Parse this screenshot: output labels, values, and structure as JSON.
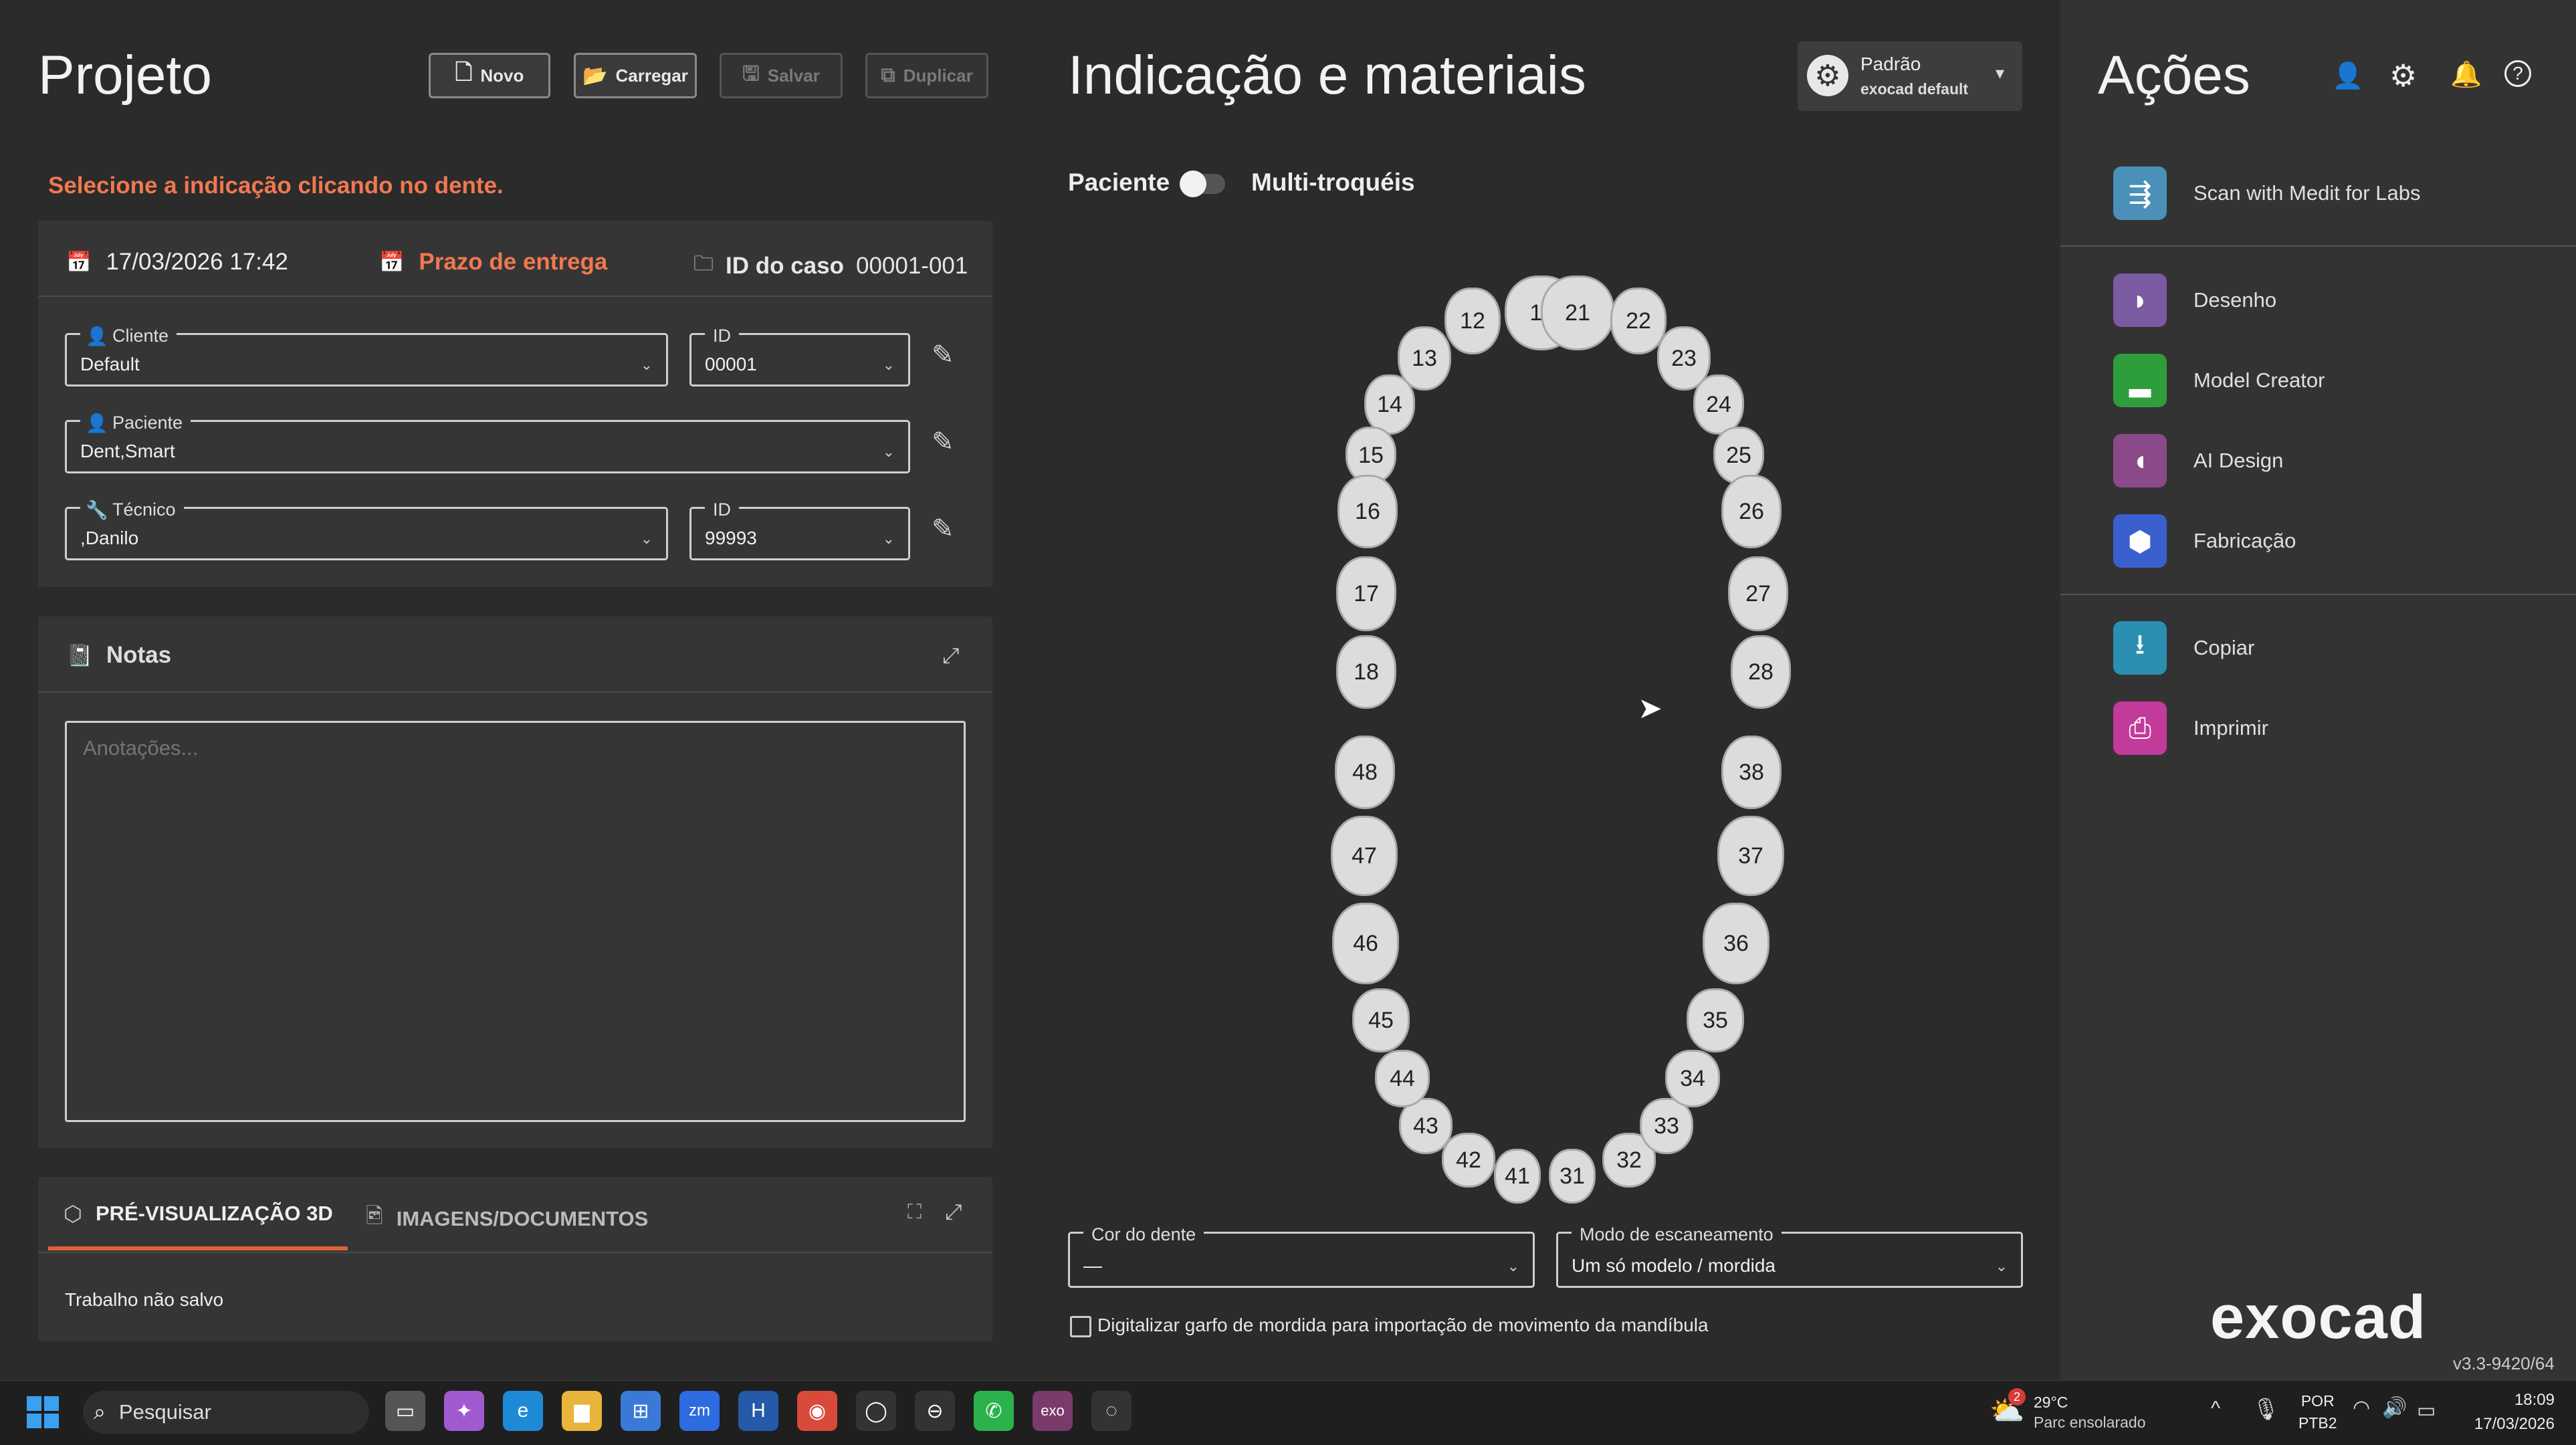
{
  "window": {
    "minimize": "–",
    "restore": "❐",
    "close": "✕"
  },
  "project": {
    "title": "Projeto",
    "buttons": {
      "new": "Novo",
      "load": "Carregar",
      "save": "Salvar",
      "duplicate": "Duplicar"
    },
    "hint": "Selecione a indicação clicando no dente.",
    "date": "17/03/2026 17:42",
    "deadline": "Prazo de entrega",
    "case_id_label": "ID do caso",
    "case_id_value": "00001-001",
    "client": {
      "label": "Cliente",
      "value": "Default"
    },
    "client_id": {
      "label": "ID",
      "value": "00001"
    },
    "patient": {
      "label": "Paciente",
      "value": "Dent,Smart"
    },
    "technician": {
      "label": "Técnico",
      "value": ",Danilo"
    },
    "tech_id": {
      "label": "ID",
      "value": "99993"
    },
    "notes": {
      "title": "Notas",
      "placeholder": "Anotações..."
    },
    "tabs": {
      "preview": "PRÉ-VISUALIZAÇÃO 3D",
      "images": "IMAGENS/DOCUMENTOS"
    },
    "status": "Trabalho não salvo"
  },
  "indication": {
    "title": "Indicação e materiais",
    "preset": {
      "name": "Padrão",
      "sub": "exocad default"
    },
    "toggle": {
      "left": "Paciente",
      "right": "Multi-troquéis"
    },
    "teeth": [
      "11",
      "12",
      "13",
      "14",
      "15",
      "16",
      "17",
      "18",
      "21",
      "22",
      "23",
      "24",
      "25",
      "26",
      "27",
      "28",
      "31",
      "32",
      "33",
      "34",
      "35",
      "36",
      "37",
      "38",
      "41",
      "42",
      "43",
      "44",
      "45",
      "46",
      "47",
      "48"
    ],
    "tooth_color": {
      "label": "Cor do dente",
      "value": "—"
    },
    "scan_mode": {
      "label": "Modo de escaneamento",
      "value": "Um só modelo / mordida"
    },
    "checkbox": "Digitalizar garfo de mordida para importação de movimento da mandíbula"
  },
  "actions": {
    "title": "Ações",
    "items": [
      {
        "label": "Scan with Medit for Labs",
        "color": "#4a90b8"
      },
      {
        "label": "Desenho",
        "color": "#7a5aa0"
      },
      {
        "label": "Model Creator",
        "color": "#2e9d3c"
      },
      {
        "label": "AI Design",
        "color": "#8a4a8a"
      },
      {
        "label": "Fabricação",
        "color": "#3a5fcf"
      },
      {
        "label": "Copiar",
        "color": "#2a8fb0"
      },
      {
        "label": "Imprimir",
        "color": "#c23a9a"
      }
    ],
    "logo": "exocad",
    "version": "v3.3-9420/64"
  },
  "taskbar": {
    "search": "Pesquisar",
    "weather_temp": "29°C",
    "weather_desc": "Parc ensolarado",
    "weather_badge": "2",
    "lang1": "POR",
    "lang2": "PTB2",
    "time": "18:09",
    "date": "17/03/2026"
  }
}
